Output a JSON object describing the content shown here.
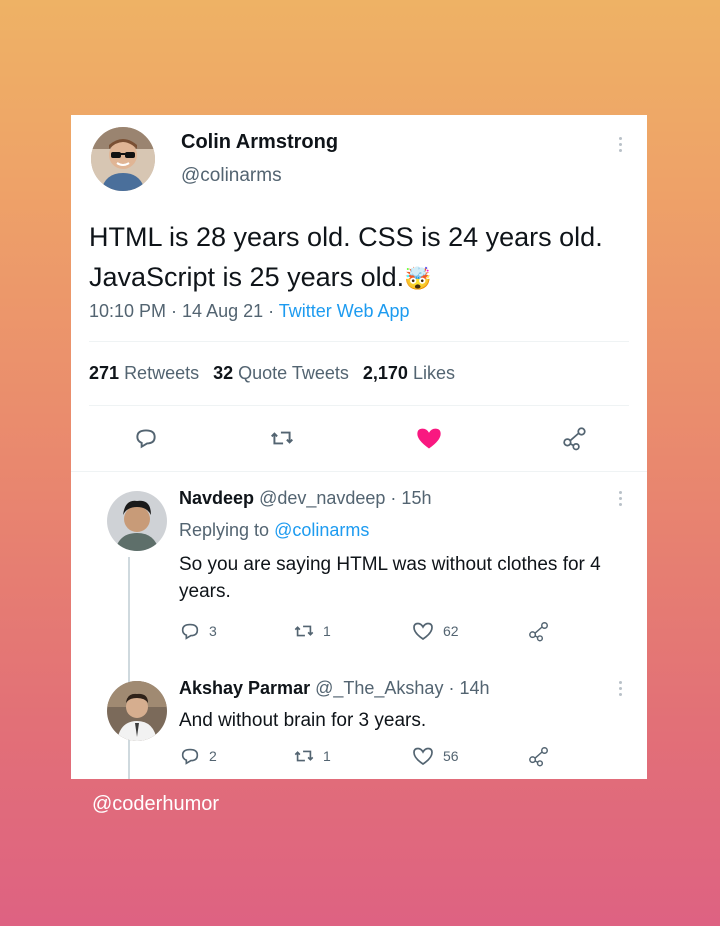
{
  "tweet": {
    "author_name": "Colin Armstrong",
    "author_handle": "@colinarms",
    "text": "HTML is 28 years old. CSS is 24 years old. JavaScript is 25 years old.",
    "emoji": "🤯",
    "time": "10:10 PM · 14 Aug 21 · ",
    "source": "Twitter Web App",
    "retweets_count": "271",
    "retweets_label": "Retweets",
    "quotes_count": "32",
    "quotes_label": "Quote Tweets",
    "likes_count": "2,170",
    "likes_label": "Likes",
    "like_color": "#f91880"
  },
  "replies": [
    {
      "name": "Navdeep",
      "handle": "@dev_navdeep · 15h",
      "replying_prefix": "Replying to ",
      "replying_to": "@colinarms",
      "text": "So you are saying HTML was without clothes for 4 years.",
      "reply_count": "3",
      "retweet_count": "1",
      "like_count": "62"
    },
    {
      "name": "Akshay Parmar",
      "handle": "@_The_Akshay · 14h",
      "text": "And without brain for 3 years.",
      "reply_count": "2",
      "retweet_count": "1",
      "like_count": "56"
    }
  ],
  "footer": {
    "credit": "@coderhumor"
  }
}
